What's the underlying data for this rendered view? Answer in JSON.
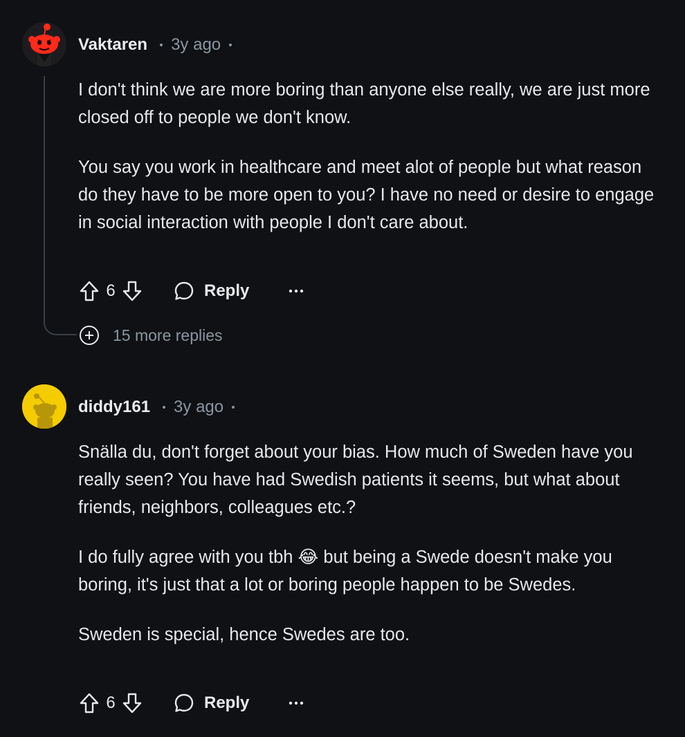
{
  "comments": [
    {
      "username": "Vaktaren",
      "age": "3y ago",
      "avatar_icon": "red-snoo-avatar-icon",
      "paragraphs": [
        "I don't think we are more boring than anyone else really, we are just more closed off to people we don't know.",
        "You say you work in healthcare and meet alot of people but what reason do they have to be more open to you? I have no need or desire to engage in social interaction with people I don't care about."
      ],
      "score": "6",
      "reply_label": "Reply",
      "more_replies": "15 more replies"
    },
    {
      "username": "diddy161",
      "age": "3y ago",
      "avatar_icon": "yellow-snoo-avatar-icon",
      "paragraphs": [
        "Snälla du, don't forget about your bias. How much of Sweden have you really seen? You have had Swedish patients it seems, but what about friends, neighbors, colleagues etc.?",
        "I do fully agree with you tbh 😂 but being a Swede doesn't make you boring, it's just that a lot or boring people happen to be Swedes.",
        "Sweden is special, hence Swedes are too."
      ],
      "score": "6",
      "reply_label": "Reply"
    }
  ],
  "colors": {
    "background": "#0f1114",
    "text": "#e6e8ea",
    "muted": "#8b96a1",
    "thread_line": "#3a3f45",
    "avatar_red": "#ff2a1a",
    "avatar_yellow": "#f5cc00"
  }
}
